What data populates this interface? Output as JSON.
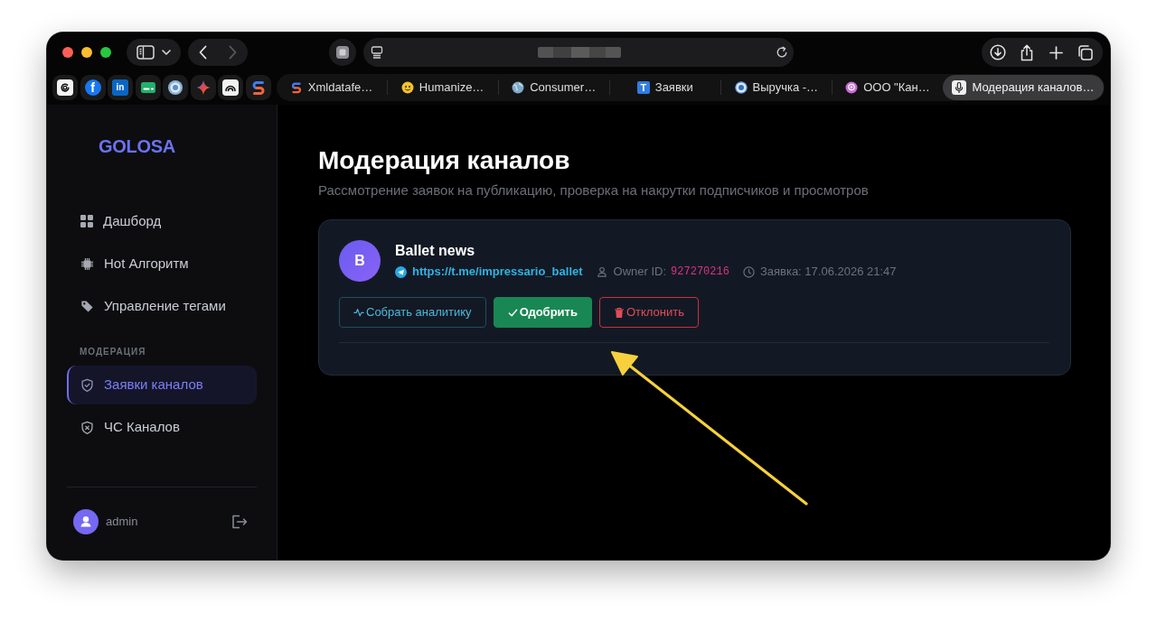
{
  "browser": {
    "navigation": {
      "back_disabled": false,
      "forward_disabled": true
    },
    "pinned_tabs": [
      {
        "kind": "icon"
      },
      {
        "kind": "letter",
        "letter": "f"
      },
      {
        "kind": "letter",
        "letter": "in"
      },
      {
        "kind": "icon"
      },
      {
        "kind": "icon"
      },
      {
        "kind": "icon"
      },
      {
        "kind": "icon"
      },
      {
        "kind": "icon"
      }
    ],
    "tabs": [
      {
        "label": "Xmldatafe…",
        "selected": false
      },
      {
        "label": "Humanize…",
        "selected": false
      },
      {
        "label": "Consumer…",
        "selected": false
      },
      {
        "label": "Заявки",
        "favicon_letter": "T",
        "selected": false
      },
      {
        "label": "Выручка -…",
        "selected": false
      },
      {
        "label": "ООО \"Кан…",
        "selected": false
      },
      {
        "label": "Модерация каналов…",
        "selected": true
      }
    ]
  },
  "sidebar": {
    "logo": "GOLOSA",
    "sections": [
      {
        "items": [
          {
            "label": "Дашборд",
            "selected": false
          },
          {
            "label": "Hot Алгоритм",
            "selected": false
          },
          {
            "label": "Управление тегами",
            "selected": false
          }
        ]
      },
      {
        "heading": "МОДЕРАЦИЯ",
        "items": [
          {
            "label": "Заявки каналов",
            "selected": true
          },
          {
            "label": "ЧС Каналов",
            "selected": false
          }
        ]
      }
    ],
    "user": {
      "name": "admin"
    }
  },
  "page": {
    "title": "Модерация каналов",
    "subtitle": "Рассмотрение заявок на публикацию, проверка на накрутки подписчиков и просмотров",
    "requests": [
      {
        "avatar": "B",
        "name": "Ballet news",
        "link": "https://t.me/impressario_ballet",
        "owner_label": "Owner ID:",
        "owner_id": "927270216",
        "submitted": "Заявка: 17.06.2026 21:47",
        "actions": [
          {
            "kind": "analytics",
            "label": "Собрать аналитику"
          },
          {
            "kind": "approve",
            "label": "Одобрить"
          },
          {
            "kind": "reject",
            "label": "Отклонить"
          }
        ]
      }
    ]
  }
}
